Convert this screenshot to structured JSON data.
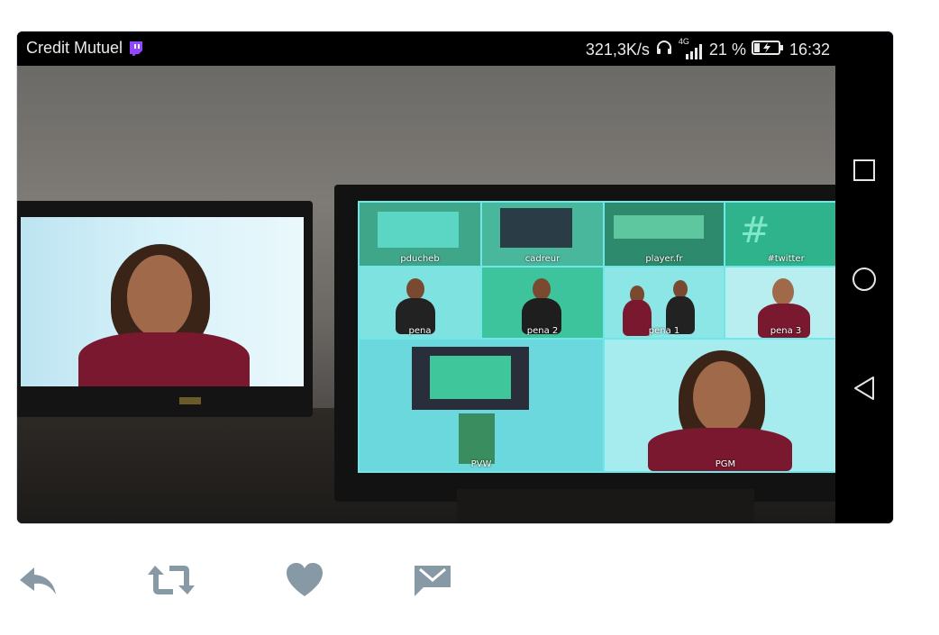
{
  "statusbar": {
    "app_name": "Credit Mutuel",
    "app_icon": "twitch-icon",
    "net_speed": "321,3K/s",
    "headphones_icon": "headphones-icon",
    "network_type": "4G",
    "signal_icon": "signal-icon",
    "battery_percent": "21 %",
    "battery_icon": "battery-charging-icon",
    "time": "16:32"
  },
  "android_nav": [
    {
      "name": "recent-apps",
      "icon": "square-icon"
    },
    {
      "name": "home",
      "icon": "circle-icon"
    },
    {
      "name": "back",
      "icon": "triangle-back-icon"
    }
  ],
  "photo": {
    "right_monitor_tiles": [
      {
        "label": "pducheb"
      },
      {
        "label": "cadreur"
      },
      {
        "label": "player.fr"
      },
      {
        "label": "#twitter"
      },
      {
        "label": "pena"
      },
      {
        "label": "pena 2"
      },
      {
        "label": "pena 1"
      },
      {
        "label": "pena 3"
      },
      {
        "label": "PVW"
      },
      {
        "label": "PGM"
      }
    ]
  },
  "tweet_actions": [
    {
      "name": "reply",
      "icon": "reply-icon"
    },
    {
      "name": "retweet",
      "icon": "retweet-icon"
    },
    {
      "name": "like",
      "icon": "heart-icon"
    },
    {
      "name": "message",
      "icon": "envelope-icon"
    }
  ],
  "colors": {
    "action_icon": "#8899a6",
    "twitch_purple": "#9146ff",
    "status_text": "#e9e9e9"
  }
}
